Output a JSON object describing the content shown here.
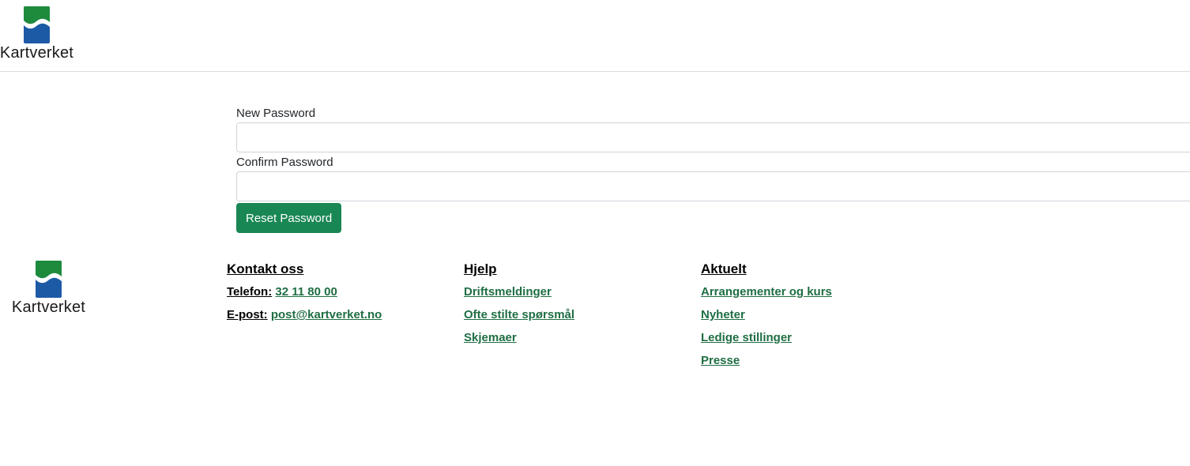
{
  "header": {
    "logo_text": "Kartverket"
  },
  "form": {
    "new_password_label": "New Password",
    "new_password_value": "",
    "confirm_password_label": "Confirm Password",
    "confirm_password_value": "",
    "submit_label": "Reset Password"
  },
  "footer": {
    "logo_text": "Kartverket",
    "contact": {
      "heading": "Kontakt oss",
      "phone_label": "Telefon:",
      "phone_value": "32 11 80 00",
      "email_label": "E-post:",
      "email_value": "post@kartverket.no"
    },
    "help": {
      "heading": "Hjelp",
      "links": [
        "Driftsmeldinger",
        "Ofte stilte spørsmål",
        "Skjemaer"
      ]
    },
    "news": {
      "heading": "Aktuelt",
      "links": [
        "Arrangementer og kurs",
        "Nyheter",
        "Ledige stillinger",
        "Presse"
      ]
    }
  },
  "colors": {
    "brand_green": "#1e8a3c",
    "brand_blue": "#1d5aa6",
    "button_green": "#198754",
    "link_green": "#1f6e43"
  },
  "icons": {
    "logo": "kartverket-logo-icon"
  }
}
